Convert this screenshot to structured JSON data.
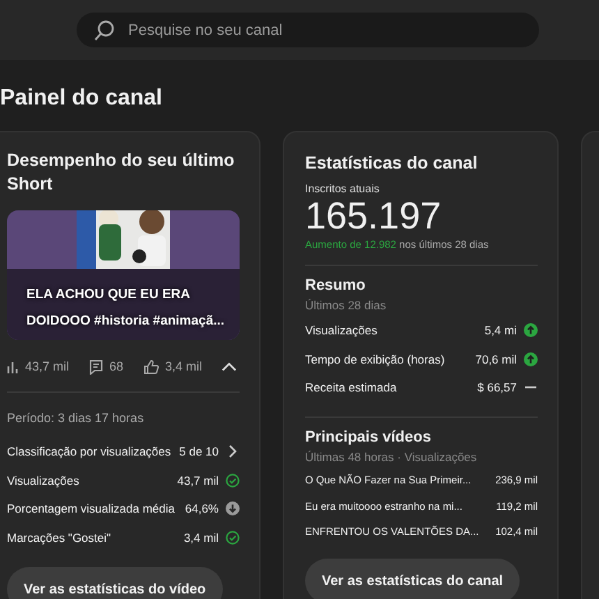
{
  "search": {
    "placeholder": "Pesquise no seu canal"
  },
  "page_title": "Painel do canal",
  "short_card": {
    "title": "Desempenho do seu último Short",
    "video_title": "ELA ACHOU QUE EU ERA DOIDOOO #historia #animaçã...",
    "views": "43,7 mil",
    "comments": "68",
    "likes": "3,4 mil",
    "expanded": true,
    "period": "Período: 3 dias 17 horas",
    "metrics": [
      {
        "label": "Classificação por visualizações",
        "value": "5 de 10",
        "kind": "link"
      },
      {
        "label": "Visualizações",
        "value": "43,7 mil",
        "kind": "check"
      },
      {
        "label": "Porcentagem visualizada média",
        "value": "64,6%",
        "kind": "down"
      },
      {
        "label": "Marcações \"Gostei\"",
        "value": "3,4 mil",
        "kind": "check"
      }
    ],
    "button": "Ver as estatísticas do vídeo"
  },
  "channel_card": {
    "title": "Estatísticas do canal",
    "subs_label": "Inscritos atuais",
    "subs": "165.197",
    "growth": "Aumento de 12.982",
    "growth_rest": " nos últimos 28 dias",
    "summary_title": "Resumo",
    "summary_sub": "Últimos 28 dias",
    "summary": [
      {
        "label": "Visualizações",
        "value": "5,4 mi",
        "kind": "up"
      },
      {
        "label": "Tempo de exibição (horas)",
        "value": "70,6 mil",
        "kind": "up"
      },
      {
        "label": "Receita estimada",
        "value": "$ 66,57",
        "kind": "neutral"
      }
    ],
    "top_title": "Principais vídeos",
    "top_sub": "Últimas 48 horas · Visualizações",
    "top_videos": [
      {
        "title": "O Que NÃO Fazer na Sua Primeir...",
        "views": "236,9 mil"
      },
      {
        "title": "Eu era muitoooo estranho na mi...",
        "views": "119,2 mil"
      },
      {
        "title": "ENFRENTOU OS VALENTÕES DA...",
        "views": "102,4 mil"
      }
    ],
    "button": "Ver as estatísticas do canal"
  }
}
